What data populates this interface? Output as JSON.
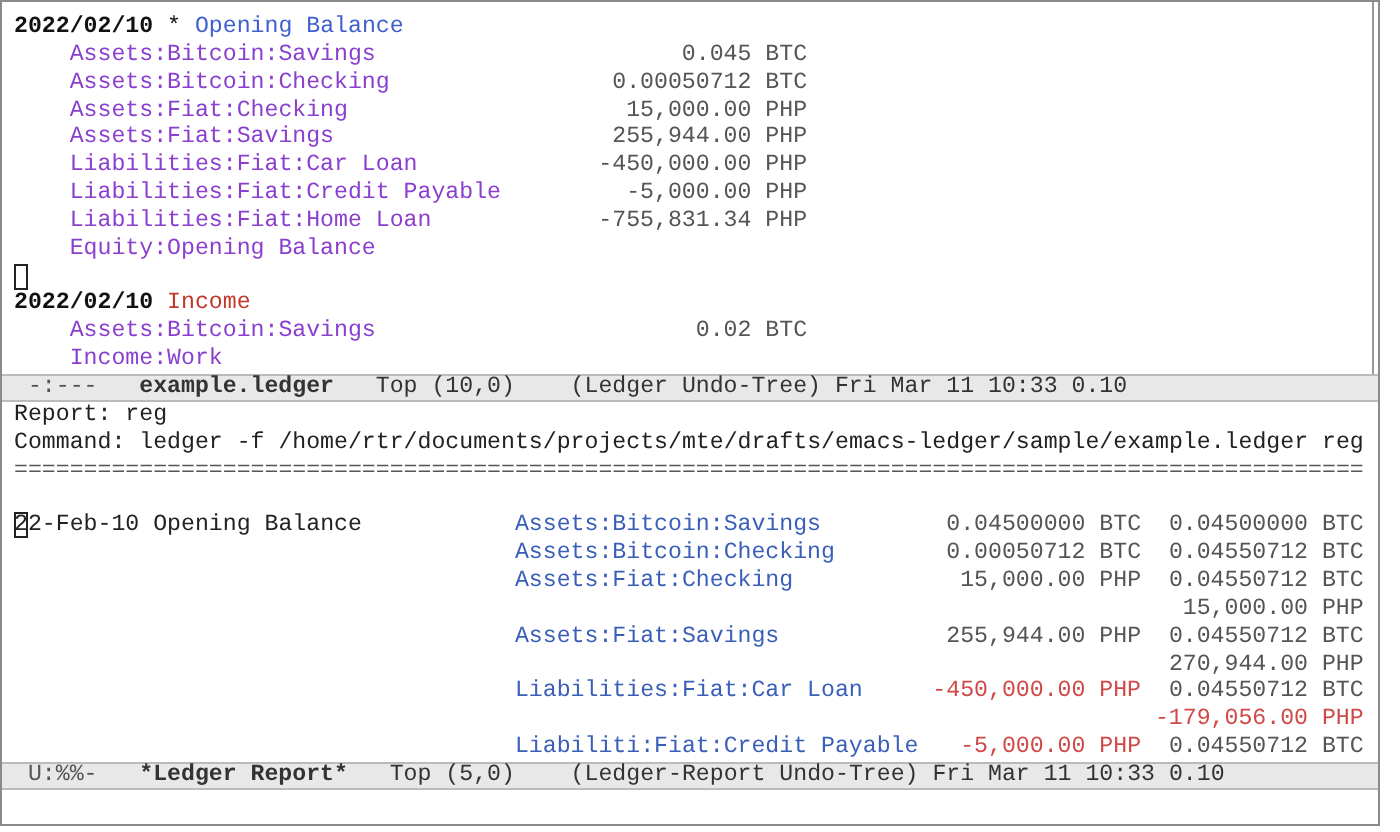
{
  "ledger_buffer": {
    "lines": [
      {
        "kind": "transaction",
        "date": "2022/02/10",
        "mark": "*",
        "payee": "Opening Balance",
        "cleared": true
      },
      {
        "kind": "posting",
        "account": "Assets:Bitcoin:Savings",
        "amount": "0.045 BTC"
      },
      {
        "kind": "posting",
        "account": "Assets:Bitcoin:Checking",
        "amount": "0.00050712 BTC"
      },
      {
        "kind": "posting",
        "account": "Assets:Fiat:Checking",
        "amount": "15,000.00 PHP"
      },
      {
        "kind": "posting",
        "account": "Assets:Fiat:Savings",
        "amount": "255,944.00 PHP"
      },
      {
        "kind": "posting",
        "account": "Liabilities:Fiat:Car Loan",
        "amount": "-450,000.00 PHP"
      },
      {
        "kind": "posting",
        "account": "Liabilities:Fiat:Credit Payable",
        "amount": "-5,000.00 PHP"
      },
      {
        "kind": "posting",
        "account": "Liabilities:Fiat:Home Loan",
        "amount": "-755,831.34 PHP"
      },
      {
        "kind": "posting",
        "account": "Equity:Opening Balance"
      },
      {
        "kind": "cursor"
      },
      {
        "kind": "transaction",
        "date": "2022/02/10",
        "payee": "Income",
        "cleared": false
      },
      {
        "kind": "posting",
        "account": "Assets:Bitcoin:Savings",
        "amount": "0.02 BTC"
      },
      {
        "kind": "posting",
        "account": "Income:Work"
      }
    ]
  },
  "mode_line_1": {
    "status": "-:---",
    "buffer": "example.ledger",
    "position": "Top (10,0)",
    "modes": "(Ledger Undo-Tree)",
    "info": "Fri Mar 11 10:33 0.10"
  },
  "report": {
    "report_line": "Report: reg",
    "command_line": "Command: ledger -f /home/rtr/documents/projects/mte/drafts/emacs-ledger/sample/example.ledger reg",
    "separator": "=================================================================================================",
    "rows": [
      {
        "date": "22-Feb-10",
        "payee": "Opening Balance",
        "cursor": true,
        "account": "Assets:Bitcoin:Savings",
        "amount": {
          "text": "0.04500000 BTC",
          "negative": false
        },
        "total": {
          "text": "0.04500000 BTC",
          "negative": false
        }
      },
      {
        "account": "Assets:Bitcoin:Checking",
        "amount": {
          "text": "0.00050712 BTC",
          "negative": false
        },
        "total": {
          "text": "0.04550712 BTC",
          "negative": false
        }
      },
      {
        "account": "Assets:Fiat:Checking",
        "amount": {
          "text": "15,000.00 PHP",
          "negative": false
        },
        "total": {
          "text": "0.04550712 BTC",
          "negative": false
        }
      },
      {
        "total": {
          "text": "15,000.00 PHP",
          "negative": false
        }
      },
      {
        "account": "Assets:Fiat:Savings",
        "amount": {
          "text": "255,944.00 PHP",
          "negative": false
        },
        "total": {
          "text": "0.04550712 BTC",
          "negative": false
        }
      },
      {
        "total": {
          "text": "270,944.00 PHP",
          "negative": false
        }
      },
      {
        "account": "Liabilities:Fiat:Car Loan",
        "amount": {
          "text": "-450,000.00 PHP",
          "negative": true
        },
        "total": {
          "text": "0.04550712 BTC",
          "negative": false
        }
      },
      {
        "total": {
          "text": "-179,056.00 PHP",
          "negative": true
        }
      },
      {
        "account": "Liabiliti:Fiat:Credit Payable",
        "amount": {
          "text": "-5,000.00 PHP",
          "negative": true
        },
        "total": {
          "text": "0.04550712 BTC",
          "negative": false
        }
      }
    ]
  },
  "mode_line_2": {
    "status": "U:%%-",
    "buffer": "*Ledger Report*",
    "position": "Top (5,0)",
    "modes": "(Ledger-Report Undo-Tree)",
    "info": "Fri Mar 11 10:33 0.10"
  }
}
